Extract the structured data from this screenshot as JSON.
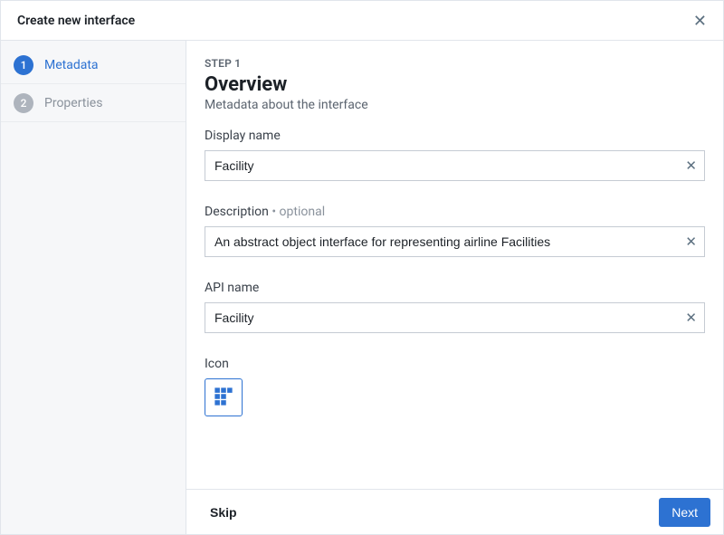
{
  "header": {
    "title": "Create new interface"
  },
  "sidebar": {
    "steps": [
      {
        "num": "1",
        "label": "Metadata",
        "active": true
      },
      {
        "num": "2",
        "label": "Properties",
        "active": false
      }
    ]
  },
  "main": {
    "eyebrow": "STEP 1",
    "title": "Overview",
    "subtitle": "Metadata about the interface",
    "fields": {
      "display_name": {
        "label": "Display name",
        "value": "Facility"
      },
      "description": {
        "label": "Description",
        "optional": "• optional",
        "value": "An abstract object interface for representing airline Facilities"
      },
      "api_name": {
        "label": "API name",
        "value": "Facility"
      },
      "icon": {
        "label": "Icon"
      }
    }
  },
  "footer": {
    "skip": "Skip",
    "next": "Next"
  }
}
